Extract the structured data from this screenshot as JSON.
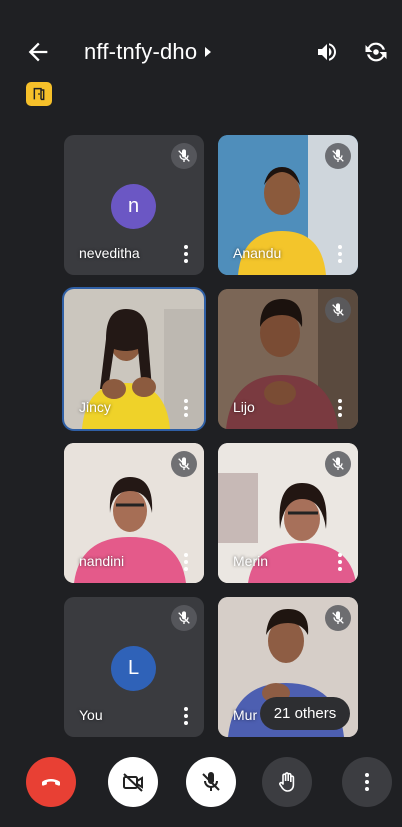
{
  "header": {
    "meeting_code": "nff-tnfy-dho",
    "icons": [
      "back-arrow-icon",
      "speaker-icon",
      "camera-flip-icon",
      "door-badge-icon"
    ]
  },
  "participants": [
    {
      "name": "neveditha",
      "avatar_letter": "n",
      "avatar_color": "#6b57c4",
      "video": false,
      "muted": true
    },
    {
      "name": "Anandu",
      "video": true,
      "muted": true,
      "bg": "#4e8db8"
    },
    {
      "name": "Jincy",
      "video": true,
      "muted": false,
      "active": true,
      "bg": "#c9c4ba"
    },
    {
      "name": "Lijo",
      "video": true,
      "muted": true,
      "bg": "#6c5a4c"
    },
    {
      "name": "nandini",
      "video": true,
      "muted": true,
      "bg": "#e7e1da"
    },
    {
      "name": "Merin",
      "video": true,
      "muted": true,
      "bg": "#e9e5df"
    },
    {
      "name": "You",
      "avatar_letter": "L",
      "avatar_color": "#2f62b8",
      "video": false,
      "muted": true
    },
    {
      "name": "Mur",
      "video": true,
      "muted": true,
      "bg": "#d4ccc6"
    }
  ],
  "overflow_label": "21 others",
  "controls": [
    "end-call",
    "camera-off",
    "mic-off",
    "raise-hand",
    "more-options"
  ]
}
